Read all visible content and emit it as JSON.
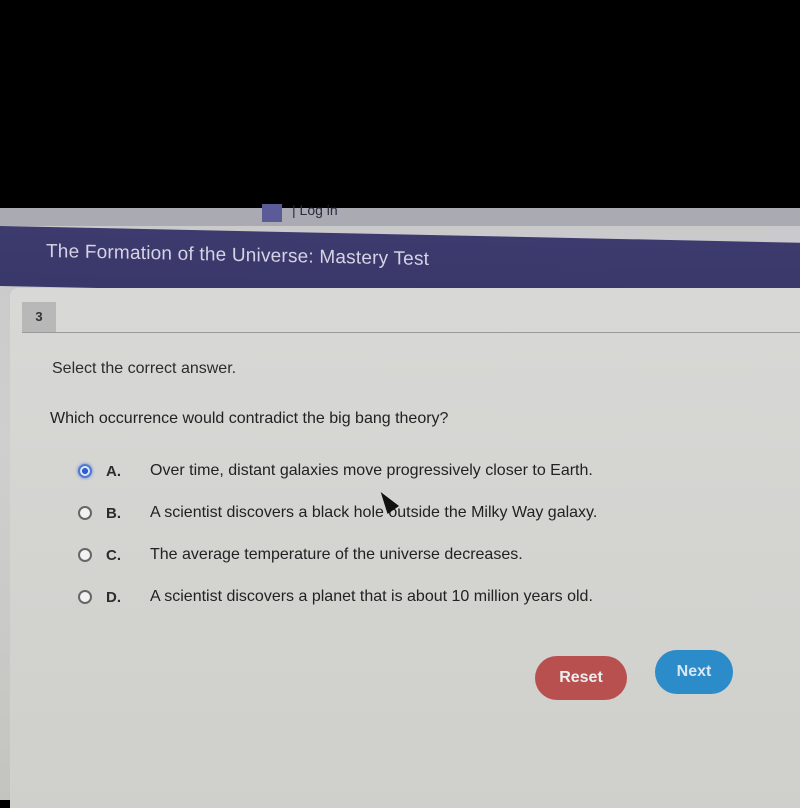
{
  "topbar": {
    "login_text": "| Log in"
  },
  "header": {
    "title": "The Formation of the Universe: Mastery Test"
  },
  "question": {
    "number": "3",
    "instruction": "Select the correct answer.",
    "prompt": "Which occurrence would contradict the big bang theory?",
    "options": [
      {
        "letter": "A.",
        "text": "Over time, distant galaxies move progressively closer to Earth.",
        "selected": true
      },
      {
        "letter": "B.",
        "text": "A scientist discovers a black hole outside the Milky Way galaxy.",
        "selected": false
      },
      {
        "letter": "C.",
        "text": "The average temperature of the universe decreases.",
        "selected": false
      },
      {
        "letter": "D.",
        "text": "A scientist discovers a planet that is about 10 million years old.",
        "selected": false
      }
    ]
  },
  "buttons": {
    "reset_label": "Reset",
    "next_label": "Next"
  },
  "colors": {
    "header_bg": "#3d3a6e",
    "reset": "#b85050",
    "next": "#2c8bc9",
    "radio_selected": "#2a5fd6"
  }
}
